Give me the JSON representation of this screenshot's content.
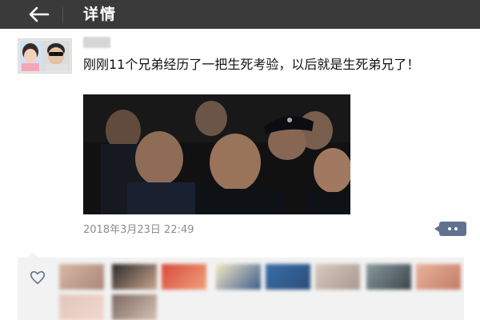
{
  "header": {
    "title": "详情",
    "back_icon": "arrow-left-icon",
    "background": "#3a3a3a"
  },
  "post": {
    "text": "刚刚11个兄弟经历了一把生死考验，以后就是生死弟兄了！",
    "timestamp": "2018年3月23日 22:49",
    "photo": "group-selfie-photo"
  },
  "actions": {
    "more_icon": "comment-more-icon",
    "accent": "#60728f"
  },
  "likes": {
    "icon": "heart-icon",
    "count_shown": 10
  }
}
